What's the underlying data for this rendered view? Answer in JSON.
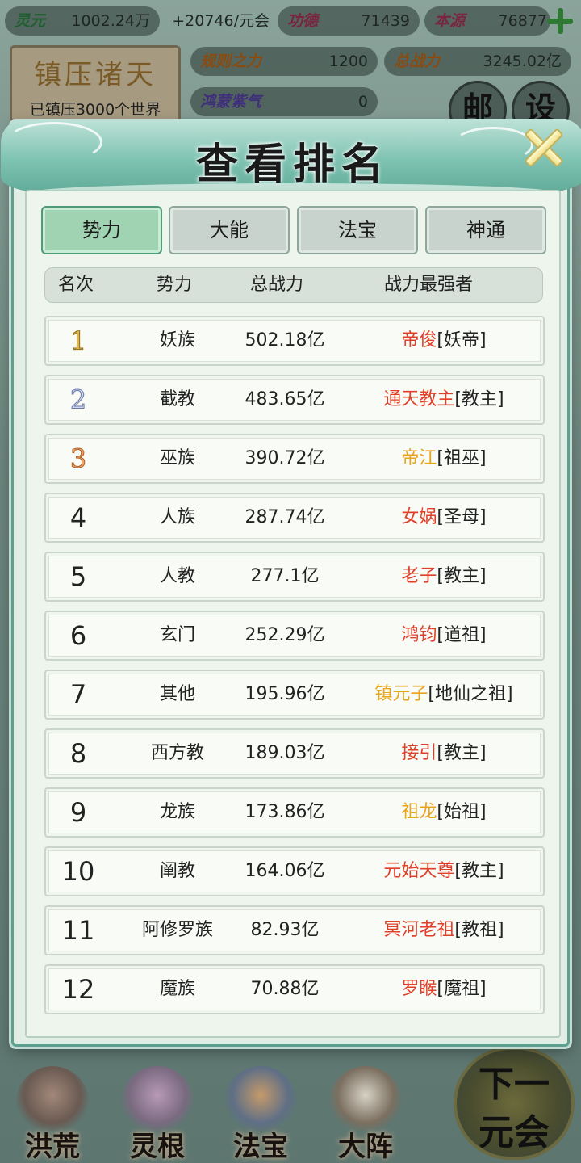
{
  "topbar": {
    "lingyuan": {
      "label": "灵元",
      "value": "1002.24万"
    },
    "rate": "+20746/元会",
    "gongde": {
      "label": "功德",
      "value": "71439"
    },
    "benyuan": {
      "label": "本源",
      "value": "76877"
    },
    "guize": {
      "label": "规则之力",
      "value": "1200"
    },
    "zongzhanli": {
      "label": "总战力",
      "value": "3245.02亿"
    },
    "hongmeng": {
      "label": "鸿蒙紫气",
      "value": "0"
    }
  },
  "seal_card": {
    "title": "镇压诸天",
    "subtitle": "已镇压3000个世界"
  },
  "side_buttons": {
    "mail": "邮",
    "settings": "设"
  },
  "modal": {
    "title": "查看排名",
    "tabs": [
      {
        "label": "势力",
        "active": true
      },
      {
        "label": "大能",
        "active": false
      },
      {
        "label": "法宝",
        "active": false
      },
      {
        "label": "神通",
        "active": false
      }
    ],
    "columns": {
      "rank": "名次",
      "faction": "势力",
      "power": "总战力",
      "strongest": "战力最强者"
    },
    "rows": [
      {
        "rank": "1",
        "faction": "妖族",
        "power": "502.18亿",
        "name": "帝俊",
        "title": "[妖帝]",
        "name_color": "#e0402a"
      },
      {
        "rank": "2",
        "faction": "截教",
        "power": "483.65亿",
        "name": "通天教主",
        "title": "[教主]",
        "name_color": "#e0402a"
      },
      {
        "rank": "3",
        "faction": "巫族",
        "power": "390.72亿",
        "name": "帝江",
        "title": "[祖巫]",
        "name_color": "#e8a41b"
      },
      {
        "rank": "4",
        "faction": "人族",
        "power": "287.74亿",
        "name": "女娲",
        "title": "[圣母]",
        "name_color": "#e0402a"
      },
      {
        "rank": "5",
        "faction": "人教",
        "power": "277.1亿",
        "name": "老子",
        "title": "[教主]",
        "name_color": "#e0402a"
      },
      {
        "rank": "6",
        "faction": "玄门",
        "power": "252.29亿",
        "name": "鸿钧",
        "title": "[道祖]",
        "name_color": "#e0402a"
      },
      {
        "rank": "7",
        "faction": "其他",
        "power": "195.96亿",
        "name": "镇元子",
        "title": "[地仙之祖]",
        "name_color": "#e8a41b"
      },
      {
        "rank": "8",
        "faction": "西方教",
        "power": "189.03亿",
        "name": "接引",
        "title": "[教主]",
        "name_color": "#e0402a"
      },
      {
        "rank": "9",
        "faction": "龙族",
        "power": "173.86亿",
        "name": "祖龙",
        "title": "[始祖]",
        "name_color": "#e8a41b"
      },
      {
        "rank": "10",
        "faction": "阐教",
        "power": "164.06亿",
        "name": "元始天尊",
        "title": "[教主]",
        "name_color": "#e0402a"
      },
      {
        "rank": "11",
        "faction": "阿修罗族",
        "power": "82.93亿",
        "name": "冥河老祖",
        "title": "[教祖]",
        "name_color": "#e0402a"
      },
      {
        "rank": "12",
        "faction": "魔族",
        "power": "70.88亿",
        "name": "罗睺",
        "title": "[魔祖]",
        "name_color": "#e0402a"
      }
    ]
  },
  "bottom_nav": {
    "items": [
      {
        "label": "洪荒",
        "icon": "mountain-icon"
      },
      {
        "label": "灵根",
        "icon": "lotus-icon"
      },
      {
        "label": "法宝",
        "icon": "treasure-icon"
      },
      {
        "label": "大阵",
        "icon": "formation-icon"
      }
    ],
    "next": {
      "line1": "下一",
      "line2": "元会"
    }
  }
}
